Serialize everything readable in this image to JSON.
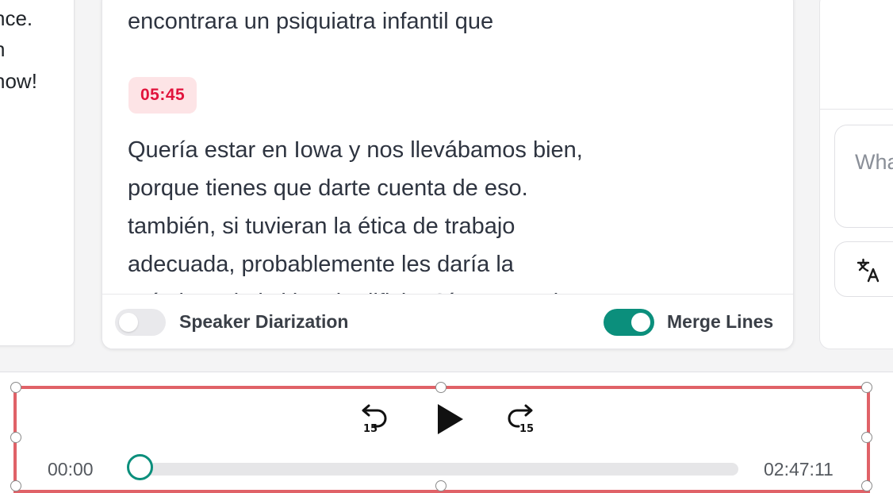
{
  "left_panel": {
    "lines": [
      "nce.",
      "n",
      "now!"
    ]
  },
  "transcript": {
    "top_line": "encontrara un psiquiatra infantil que",
    "timestamp": "05:45",
    "lines": [
      "Quería estar en Iowa y nos llevábamos bien,",
      "porque tienes que darte cuenta de eso.",
      "también, si tuvieran la ética de trabajo",
      "adecuada, probablemente les daría la",
      "práctica, ni el sitio, ni edificio. Sí. Pero a el"
    ]
  },
  "footer": {
    "speaker_diarization_label": "Speaker Diarization",
    "speaker_diarization_on": false,
    "merge_lines_label": "Merge Lines",
    "merge_lines_on": true
  },
  "right_panel": {
    "ask_placeholder": "Wha",
    "translate_icon": "translate-icon"
  },
  "player": {
    "rewind_icon": "rewind-15-icon",
    "play_icon": "play-icon",
    "forward_icon": "forward-15-icon",
    "current_time": "00:00",
    "total_time": "02:47:11",
    "progress": 0.0
  },
  "colors": {
    "accent": "#0b8f7c",
    "timestamp_bg": "#fde4e6",
    "timestamp_text": "#e1133c",
    "selection_border": "#e06268"
  }
}
